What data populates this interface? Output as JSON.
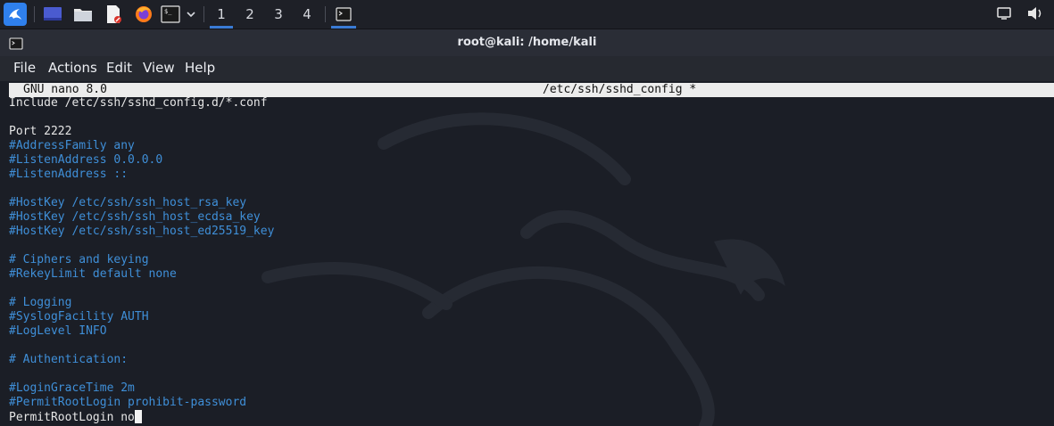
{
  "taskbar": {
    "workspaces": [
      {
        "label": "1",
        "active": true
      },
      {
        "label": "2",
        "active": false
      },
      {
        "label": "3",
        "active": false
      },
      {
        "label": "4",
        "active": false
      }
    ],
    "accent_color": "#3a7bd5"
  },
  "window": {
    "title": "root@kali: /home/kali"
  },
  "menu": {
    "file": "File",
    "actions": "Actions",
    "edit": "Edit",
    "view": "View",
    "help": "Help"
  },
  "nano": {
    "version": "GNU nano 8.0",
    "filename": "/etc/ssh/sshd_config *",
    "lines": [
      {
        "text": "Include /etc/ssh/sshd_config.d/*.conf",
        "comment": false
      },
      {
        "text": "",
        "comment": false
      },
      {
        "text": "Port 2222",
        "comment": false
      },
      {
        "text": "#AddressFamily any",
        "comment": true
      },
      {
        "text": "#ListenAddress 0.0.0.0",
        "comment": true
      },
      {
        "text": "#ListenAddress ::",
        "comment": true
      },
      {
        "text": "",
        "comment": false
      },
      {
        "text": "#HostKey /etc/ssh/ssh_host_rsa_key",
        "comment": true
      },
      {
        "text": "#HostKey /etc/ssh/ssh_host_ecdsa_key",
        "comment": true
      },
      {
        "text": "#HostKey /etc/ssh/ssh_host_ed25519_key",
        "comment": true
      },
      {
        "text": "",
        "comment": false
      },
      {
        "text": "# Ciphers and keying",
        "comment": true
      },
      {
        "text": "#RekeyLimit default none",
        "comment": true
      },
      {
        "text": "",
        "comment": false
      },
      {
        "text": "# Logging",
        "comment": true
      },
      {
        "text": "#SyslogFacility AUTH",
        "comment": true
      },
      {
        "text": "#LogLevel INFO",
        "comment": true
      },
      {
        "text": "",
        "comment": false
      },
      {
        "text": "# Authentication:",
        "comment": true
      },
      {
        "text": "",
        "comment": false
      },
      {
        "text": "#LoginGraceTime 2m",
        "comment": true
      },
      {
        "text": "#PermitRootLogin prohibit-password",
        "comment": true
      },
      {
        "text": "PermitRootLogin no",
        "comment": false
      }
    ],
    "comment_color": "#3f8fd8"
  }
}
